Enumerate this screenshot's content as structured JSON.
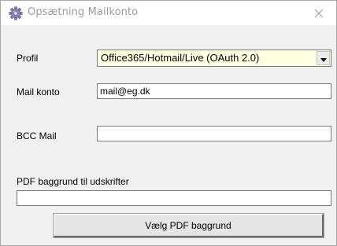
{
  "window": {
    "title": "Opsætning Mailkonto",
    "title_icon": "gear-settings-icon",
    "close_icon": "close-icon"
  },
  "form": {
    "profile": {
      "label": "Profil",
      "selected": "Office365/Hotmail/Live (OAuth 2.0)"
    },
    "mail_account": {
      "label": "Mail konto",
      "value": "mail@eg.dk"
    },
    "bcc_mail": {
      "label": "BCC Mail",
      "value": ""
    },
    "pdf_background": {
      "label": "PDF baggrund til udskrifter",
      "value": "",
      "button_label": "Vælg PDF baggrund"
    }
  },
  "colors": {
    "combo_background": "#ffffe1",
    "title_text": "#9a9a9a"
  }
}
